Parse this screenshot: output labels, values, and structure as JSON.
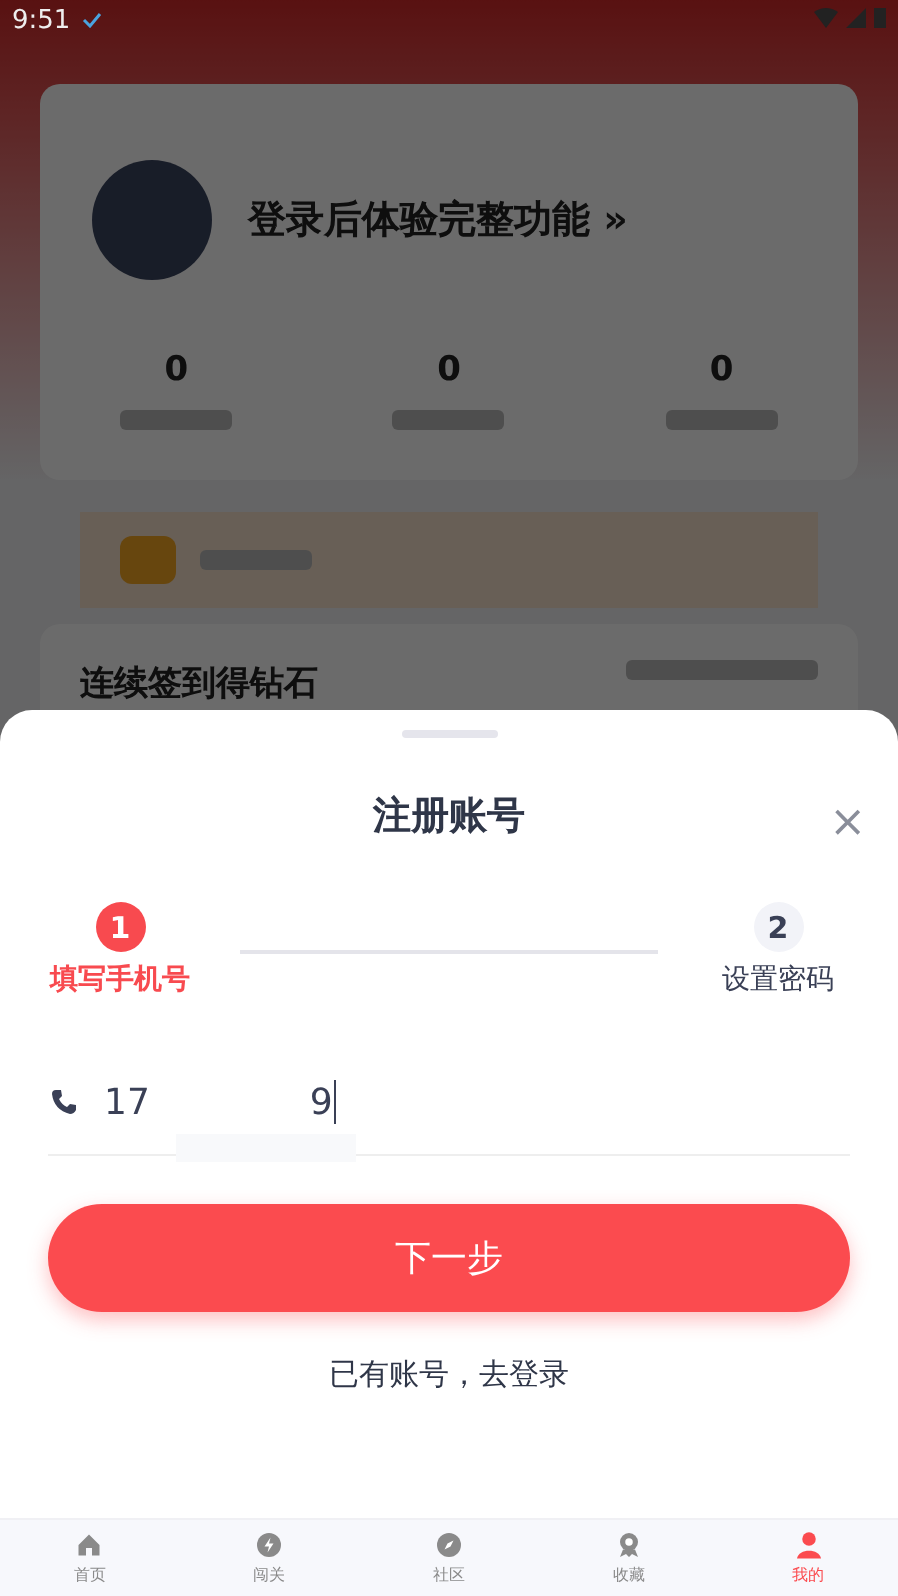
{
  "status_bar": {
    "time": "9:51"
  },
  "background": {
    "profile_title": "登录后体验完整功能 »",
    "stats": [
      {
        "value": "0"
      },
      {
        "value": "0"
      },
      {
        "value": "0"
      }
    ],
    "checkin_title": "连续签到得钻石"
  },
  "sheet": {
    "title": "注册账号",
    "close": "×",
    "steps": [
      {
        "number": "1",
        "label": "填写手机号",
        "selected": true
      },
      {
        "number": "2",
        "label": "设置密码",
        "selected": false
      }
    ],
    "phone": {
      "value_start": "17",
      "value_end": "9"
    },
    "next_button": "下一步",
    "login_link": "已有账号，去登录"
  },
  "tabs": [
    {
      "label": "首页",
      "selected": false
    },
    {
      "label": "闯关",
      "selected": false
    },
    {
      "label": "社区",
      "selected": false
    },
    {
      "label": "收藏",
      "selected": false
    },
    {
      "label": "我的",
      "selected": true
    }
  ]
}
